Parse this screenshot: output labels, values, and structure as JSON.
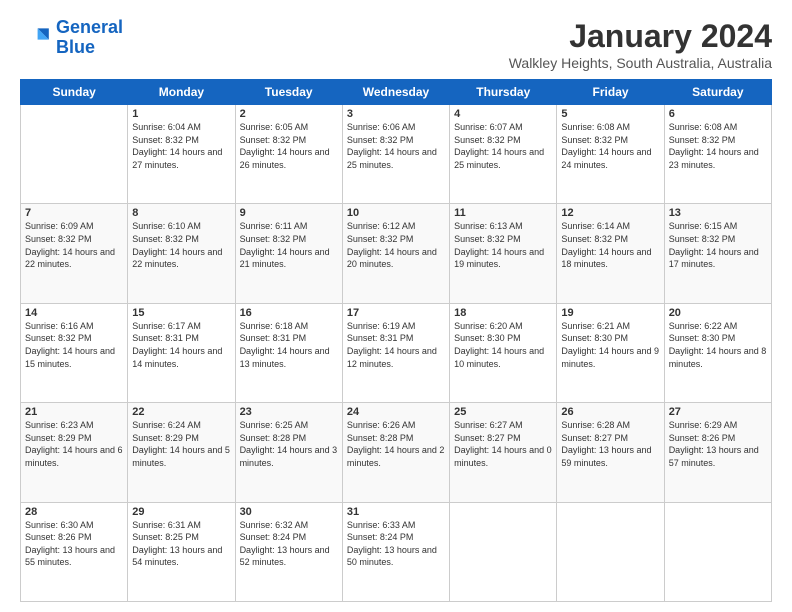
{
  "header": {
    "logo_line1": "General",
    "logo_line2": "Blue",
    "main_title": "January 2024",
    "subtitle": "Walkley Heights, South Australia, Australia"
  },
  "days_of_week": [
    "Sunday",
    "Monday",
    "Tuesday",
    "Wednesday",
    "Thursday",
    "Friday",
    "Saturday"
  ],
  "weeks": [
    [
      {
        "day": "",
        "sunrise": "",
        "sunset": "",
        "daylight": ""
      },
      {
        "day": "1",
        "sunrise": "Sunrise: 6:04 AM",
        "sunset": "Sunset: 8:32 PM",
        "daylight": "Daylight: 14 hours and 27 minutes."
      },
      {
        "day": "2",
        "sunrise": "Sunrise: 6:05 AM",
        "sunset": "Sunset: 8:32 PM",
        "daylight": "Daylight: 14 hours and 26 minutes."
      },
      {
        "day": "3",
        "sunrise": "Sunrise: 6:06 AM",
        "sunset": "Sunset: 8:32 PM",
        "daylight": "Daylight: 14 hours and 25 minutes."
      },
      {
        "day": "4",
        "sunrise": "Sunrise: 6:07 AM",
        "sunset": "Sunset: 8:32 PM",
        "daylight": "Daylight: 14 hours and 25 minutes."
      },
      {
        "day": "5",
        "sunrise": "Sunrise: 6:08 AM",
        "sunset": "Sunset: 8:32 PM",
        "daylight": "Daylight: 14 hours and 24 minutes."
      },
      {
        "day": "6",
        "sunrise": "Sunrise: 6:08 AM",
        "sunset": "Sunset: 8:32 PM",
        "daylight": "Daylight: 14 hours and 23 minutes."
      }
    ],
    [
      {
        "day": "7",
        "sunrise": "Sunrise: 6:09 AM",
        "sunset": "Sunset: 8:32 PM",
        "daylight": "Daylight: 14 hours and 22 minutes."
      },
      {
        "day": "8",
        "sunrise": "Sunrise: 6:10 AM",
        "sunset": "Sunset: 8:32 PM",
        "daylight": "Daylight: 14 hours and 22 minutes."
      },
      {
        "day": "9",
        "sunrise": "Sunrise: 6:11 AM",
        "sunset": "Sunset: 8:32 PM",
        "daylight": "Daylight: 14 hours and 21 minutes."
      },
      {
        "day": "10",
        "sunrise": "Sunrise: 6:12 AM",
        "sunset": "Sunset: 8:32 PM",
        "daylight": "Daylight: 14 hours and 20 minutes."
      },
      {
        "day": "11",
        "sunrise": "Sunrise: 6:13 AM",
        "sunset": "Sunset: 8:32 PM",
        "daylight": "Daylight: 14 hours and 19 minutes."
      },
      {
        "day": "12",
        "sunrise": "Sunrise: 6:14 AM",
        "sunset": "Sunset: 8:32 PM",
        "daylight": "Daylight: 14 hours and 18 minutes."
      },
      {
        "day": "13",
        "sunrise": "Sunrise: 6:15 AM",
        "sunset": "Sunset: 8:32 PM",
        "daylight": "Daylight: 14 hours and 17 minutes."
      }
    ],
    [
      {
        "day": "14",
        "sunrise": "Sunrise: 6:16 AM",
        "sunset": "Sunset: 8:32 PM",
        "daylight": "Daylight: 14 hours and 15 minutes."
      },
      {
        "day": "15",
        "sunrise": "Sunrise: 6:17 AM",
        "sunset": "Sunset: 8:31 PM",
        "daylight": "Daylight: 14 hours and 14 minutes."
      },
      {
        "day": "16",
        "sunrise": "Sunrise: 6:18 AM",
        "sunset": "Sunset: 8:31 PM",
        "daylight": "Daylight: 14 hours and 13 minutes."
      },
      {
        "day": "17",
        "sunrise": "Sunrise: 6:19 AM",
        "sunset": "Sunset: 8:31 PM",
        "daylight": "Daylight: 14 hours and 12 minutes."
      },
      {
        "day": "18",
        "sunrise": "Sunrise: 6:20 AM",
        "sunset": "Sunset: 8:30 PM",
        "daylight": "Daylight: 14 hours and 10 minutes."
      },
      {
        "day": "19",
        "sunrise": "Sunrise: 6:21 AM",
        "sunset": "Sunset: 8:30 PM",
        "daylight": "Daylight: 14 hours and 9 minutes."
      },
      {
        "day": "20",
        "sunrise": "Sunrise: 6:22 AM",
        "sunset": "Sunset: 8:30 PM",
        "daylight": "Daylight: 14 hours and 8 minutes."
      }
    ],
    [
      {
        "day": "21",
        "sunrise": "Sunrise: 6:23 AM",
        "sunset": "Sunset: 8:29 PM",
        "daylight": "Daylight: 14 hours and 6 minutes."
      },
      {
        "day": "22",
        "sunrise": "Sunrise: 6:24 AM",
        "sunset": "Sunset: 8:29 PM",
        "daylight": "Daylight: 14 hours and 5 minutes."
      },
      {
        "day": "23",
        "sunrise": "Sunrise: 6:25 AM",
        "sunset": "Sunset: 8:28 PM",
        "daylight": "Daylight: 14 hours and 3 minutes."
      },
      {
        "day": "24",
        "sunrise": "Sunrise: 6:26 AM",
        "sunset": "Sunset: 8:28 PM",
        "daylight": "Daylight: 14 hours and 2 minutes."
      },
      {
        "day": "25",
        "sunrise": "Sunrise: 6:27 AM",
        "sunset": "Sunset: 8:27 PM",
        "daylight": "Daylight: 14 hours and 0 minutes."
      },
      {
        "day": "26",
        "sunrise": "Sunrise: 6:28 AM",
        "sunset": "Sunset: 8:27 PM",
        "daylight": "Daylight: 13 hours and 59 minutes."
      },
      {
        "day": "27",
        "sunrise": "Sunrise: 6:29 AM",
        "sunset": "Sunset: 8:26 PM",
        "daylight": "Daylight: 13 hours and 57 minutes."
      }
    ],
    [
      {
        "day": "28",
        "sunrise": "Sunrise: 6:30 AM",
        "sunset": "Sunset: 8:26 PM",
        "daylight": "Daylight: 13 hours and 55 minutes."
      },
      {
        "day": "29",
        "sunrise": "Sunrise: 6:31 AM",
        "sunset": "Sunset: 8:25 PM",
        "daylight": "Daylight: 13 hours and 54 minutes."
      },
      {
        "day": "30",
        "sunrise": "Sunrise: 6:32 AM",
        "sunset": "Sunset: 8:24 PM",
        "daylight": "Daylight: 13 hours and 52 minutes."
      },
      {
        "day": "31",
        "sunrise": "Sunrise: 6:33 AM",
        "sunset": "Sunset: 8:24 PM",
        "daylight": "Daylight: 13 hours and 50 minutes."
      },
      {
        "day": "",
        "sunrise": "",
        "sunset": "",
        "daylight": ""
      },
      {
        "day": "",
        "sunrise": "",
        "sunset": "",
        "daylight": ""
      },
      {
        "day": "",
        "sunrise": "",
        "sunset": "",
        "daylight": ""
      }
    ]
  ]
}
